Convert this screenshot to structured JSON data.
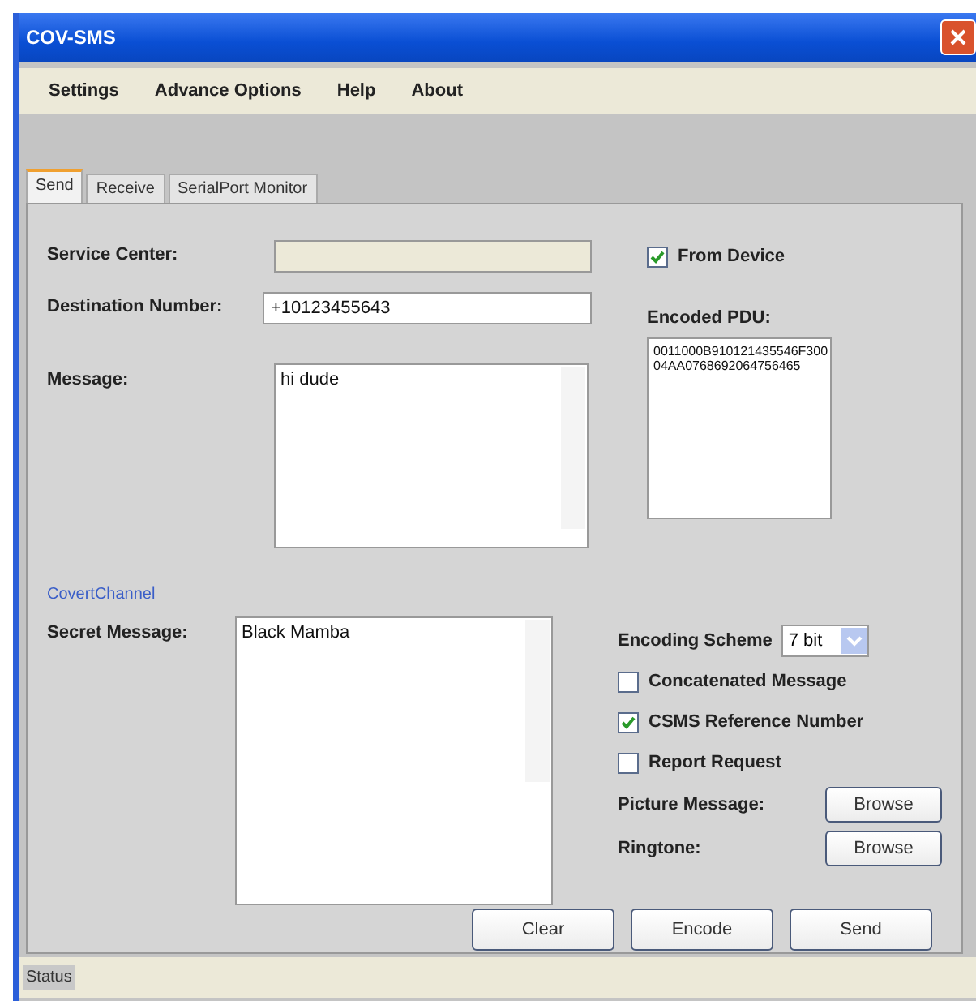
{
  "window": {
    "title": "COV-SMS"
  },
  "menu": [
    "Settings",
    "Advance Options",
    "Help",
    "About"
  ],
  "tabs": [
    {
      "label": "Send",
      "selected": true
    },
    {
      "label": "Receive",
      "selected": false
    },
    {
      "label": "SerialPort Monitor",
      "selected": false
    }
  ],
  "service_center": {
    "label": "Service Center:",
    "disabled": true
  },
  "from_device": {
    "label": "From Device",
    "checked": true
  },
  "destination": {
    "label": "Destination Number:",
    "value": "+10123455643"
  },
  "message": {
    "label": "Message:",
    "value": "hi dude"
  },
  "encoded_pdu": {
    "label": "Encoded PDU:",
    "value": "0011000B910121435546F300\n04AA0768692064756465"
  },
  "covert_link": "CovertChannel",
  "secret_message": {
    "label": "Secret Message:",
    "value": "Black Mamba"
  },
  "encoding_scheme": {
    "label": "Encoding Scheme",
    "value": "7 bit"
  },
  "options": [
    {
      "label": "Concatenated Message",
      "checked": false
    },
    {
      "label": "CSMS Reference Number",
      "checked": true
    },
    {
      "label": "Report Request",
      "checked": false
    }
  ],
  "picture_message": {
    "label": "Picture Message:",
    "button": "Browse"
  },
  "ringtone": {
    "label": "Ringtone:",
    "button": "Browse"
  },
  "buttons": [
    "Clear",
    "Encode",
    "Send"
  ],
  "status_bar": "Status"
}
